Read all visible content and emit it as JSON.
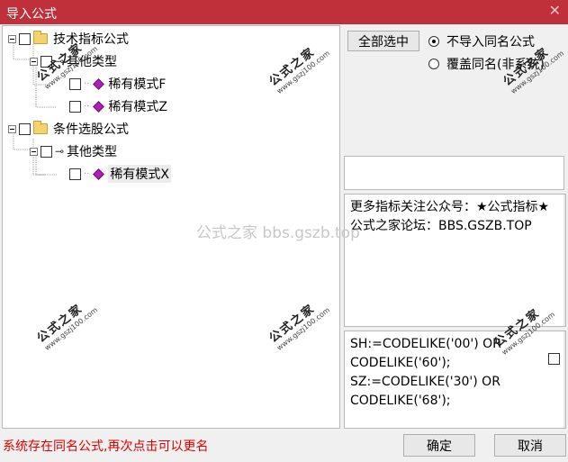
{
  "window": {
    "title": "导入公式",
    "close_glyph": "✕"
  },
  "tree": {
    "nodes": [
      {
        "label": "技术指标公式",
        "kind": "folder"
      },
      {
        "label": "其他类型",
        "kind": "category"
      },
      {
        "label": "稀有模式F",
        "kind": "formula"
      },
      {
        "label": "稀有模式Z",
        "kind": "formula"
      },
      {
        "label": "条件选股公式",
        "kind": "folder"
      },
      {
        "label": "其他类型",
        "kind": "category"
      },
      {
        "label": "稀有模式X",
        "kind": "formula",
        "selected": true
      }
    ]
  },
  "buttons": {
    "select_all": "全部选中",
    "ok": "确定",
    "cancel": "取消"
  },
  "options": {
    "no_import_same_name": {
      "label": "不导入同名公式",
      "checked": true
    },
    "overwrite_same_name": {
      "label": "覆盖同名(非系统)",
      "checked": false
    }
  },
  "info_text": "更多指标关注公众号：★公式指标★公式之家论坛：BBS.GSZB.TOP",
  "code_text": "SH:=CODELIKE('00') OR CODELIKE('60'); SZ:=CODELIKE('30') OR CODELIKE('68');",
  "status_text": "系统存在同名公式,再次点击可以更名",
  "watermark": {
    "text": "公式之家 bbs.gszb.top",
    "stamp_big": "公式之家",
    "stamp_small": "www.gszj100.com"
  },
  "colors": {
    "titlebar": "#c0303a",
    "status": "#e00000",
    "gem": "#b01fb8",
    "folder": "#f5d36c"
  },
  "icons": {
    "folder": "folder-icon",
    "key": "key-icon",
    "formula": "gem-icon",
    "close": "close-icon"
  }
}
